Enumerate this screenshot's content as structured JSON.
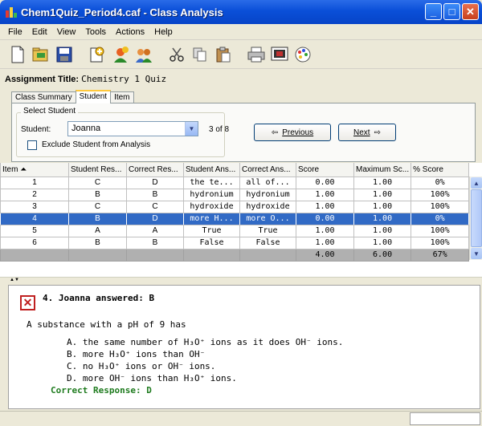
{
  "window": {
    "title": "Chem1Quiz_Period4.caf - Class Analysis"
  },
  "menu": [
    "File",
    "Edit",
    "View",
    "Tools",
    "Actions",
    "Help"
  ],
  "toolbar": {
    "icons": [
      "new-icon",
      "open-icon",
      "save-icon",
      "add-item-icon",
      "add-student-icon",
      "students-icon",
      "cut-icon",
      "copy-icon",
      "paste-icon",
      "print-icon",
      "slideshow-icon",
      "palette-icon"
    ]
  },
  "assignment": {
    "label": "Assignment Title:",
    "value": "Chemistry 1 Quiz"
  },
  "tabs": [
    "Class Summary",
    "Student",
    "Item"
  ],
  "select_student": {
    "legend": "Select Student",
    "student_label": "Student:",
    "student_value": "Joanna",
    "count": "3 of 8",
    "exclude_label": "Exclude Student from Analysis",
    "previous_label": "Previous",
    "next_label": "Next"
  },
  "table": {
    "headers": [
      "Item ⏶",
      "Student Res...",
      "Correct Res...",
      "Student Ans...",
      "Correct Ans...",
      "Score",
      "Maximum Sc...",
      "% Score"
    ],
    "rows": [
      [
        "1",
        "C",
        "D",
        "the te...",
        "all of...",
        "0.00",
        "1.00",
        "0%"
      ],
      [
        "2",
        "B",
        "B",
        "hydronium",
        "hydronium",
        "1.00",
        "1.00",
        "100%"
      ],
      [
        "3",
        "C",
        "C",
        "hydroxide",
        "hydroxide",
        "1.00",
        "1.00",
        "100%"
      ],
      [
        "4",
        "B",
        "D",
        "more H...",
        "more O...",
        "0.00",
        "1.00",
        "0%"
      ],
      [
        "5",
        "A",
        "A",
        "True",
        "True",
        "1.00",
        "1.00",
        "100%"
      ],
      [
        "6",
        "B",
        "B",
        "False",
        "False",
        "1.00",
        "1.00",
        "100%"
      ]
    ],
    "totals": [
      "",
      "",
      "",
      "",
      "",
      "4.00",
      "6.00",
      "67%"
    ]
  },
  "detail": {
    "heading": "4. Joanna answered: B",
    "question": "A substance with a pH of 9 has",
    "choices": [
      "A. the same number of H₃O⁺ ions as it does OH⁻ ions.",
      "B. more H₃O⁺ ions than OH⁻",
      "C. no H₃O⁺ ions or OH⁻ ions.",
      "D. more OH⁻ ions than H₃O⁺ ions."
    ],
    "correct": "Correct Response: D"
  }
}
